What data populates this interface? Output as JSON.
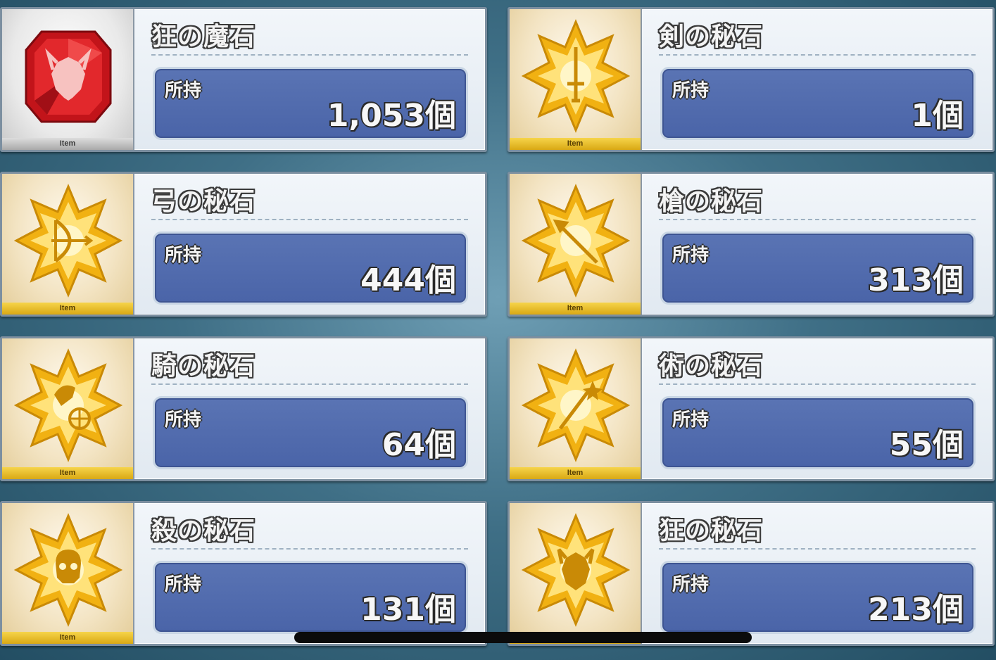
{
  "item_tag": "Item",
  "owned_label": "所持",
  "items": [
    {
      "name": "狂の魔石",
      "count": "1,053個",
      "icon": "berserker-gem-icon",
      "color": "#d8201f"
    },
    {
      "name": "剣の秘石",
      "count": "1個",
      "icon": "saber-gem-icon",
      "color": "#f2b91c"
    },
    {
      "name": "弓の秘石",
      "count": "444個",
      "icon": "archer-gem-icon",
      "color": "#f2b91c"
    },
    {
      "name": "槍の秘石",
      "count": "313個",
      "icon": "lancer-gem-icon",
      "color": "#f2b91c"
    },
    {
      "name": "騎の秘石",
      "count": "64個",
      "icon": "rider-gem-icon",
      "color": "#f2b91c"
    },
    {
      "name": "術の秘石",
      "count": "55個",
      "icon": "caster-gem-icon",
      "color": "#f2b91c"
    },
    {
      "name": "殺の秘石",
      "count": "131個",
      "icon": "assassin-gem-icon",
      "color": "#f2b91c"
    },
    {
      "name": "狂の秘石",
      "count": "213個",
      "icon": "berserker-gem-icon",
      "color": "#f2b91c"
    }
  ]
}
